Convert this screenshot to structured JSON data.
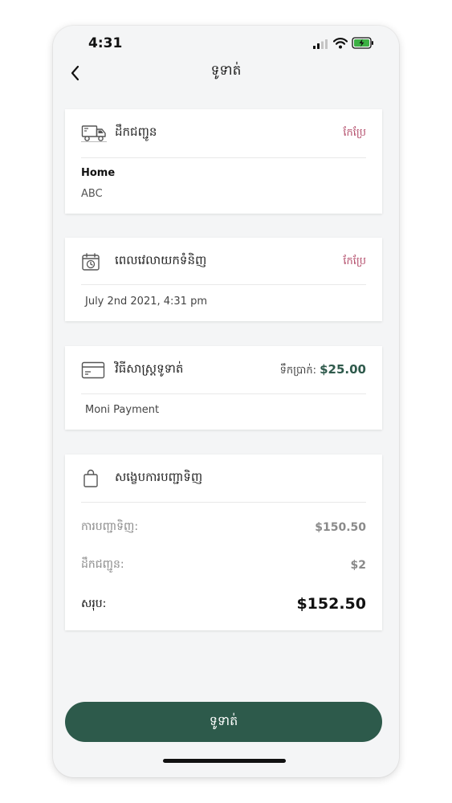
{
  "status_bar": {
    "time": "4:31"
  },
  "header": {
    "title": "ទូទាត់"
  },
  "delivery": {
    "title": "ដឹកជញ្ជូន",
    "edit_label": "កែប្រែ",
    "address_label": "Home",
    "address_value": "ABC"
  },
  "schedule": {
    "title": "ពេលវេលាយកទំនិញ",
    "edit_label": "កែប្រែ",
    "datetime": "July 2nd 2021, 4:31 pm"
  },
  "payment": {
    "title": "វិធីសាស្រ្តទូទាត់",
    "amount_label": "ទឹកប្រាក់:",
    "amount_value": "$25.00",
    "method": "Moni Payment"
  },
  "summary": {
    "title": "សង្ខេបការបញ្ជាទិញ",
    "rows": [
      {
        "label": "ការបញ្ជាទិញ:",
        "value": "$150.50"
      },
      {
        "label": "ដឹកជញ្ជូន:",
        "value": "$2"
      }
    ],
    "total_label": "សរុប:",
    "total_value": "$152.50"
  },
  "footer": {
    "pay_button_label": "ទូទាត់"
  },
  "colors": {
    "accent": "#2d5a4b",
    "edit_link": "#b5516e",
    "background": "#f4f5f6",
    "battery": "#3cb043"
  },
  "icons": {
    "back": "chevron-left-icon",
    "delivery": "truck-icon",
    "schedule": "calendar-clock-icon",
    "payment": "credit-card-icon",
    "summary": "shopping-bag-icon"
  }
}
